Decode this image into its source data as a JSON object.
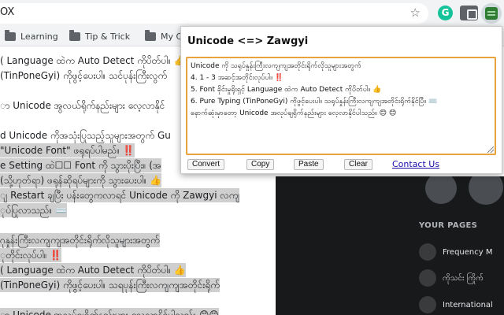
{
  "browser": {
    "url_fragment": "OX",
    "bookmarks": [
      "Learning",
      "Tip & Trick",
      "My C"
    ],
    "extension_icons": [
      "grammarly-icon",
      "bulb-extension-icon",
      "camera-extension-icon",
      "unicode-zawgyi-extension-icon"
    ]
  },
  "page": {
    "lines": [
      {
        "text": "( Language ထဲက Auto Detect ကိုပိတ်ပါ။ 👍",
        "selected": false
      },
      {
        "text": "(TinPoneGyi) ကိုဖွင့်ပေးပါ။ သင်ပုန်းကြီးလွက်",
        "selected": false
      },
      {
        "text": "",
        "selected": false
      },
      {
        "text": "ာ Unicode အွလယ်ရိုက်နည်းများ လေ့လာနိုင်",
        "selected": false
      },
      {
        "text": "",
        "selected": false
      },
      {
        "text": "d Unicode ကိုအသုံးပြုသည့်သူများအတွက် Gu",
        "selected": false
      },
      {
        "text": "\"Unicode Font\" ဖရုရပ်ပါမည်။ ‼️",
        "selected": true
      },
      {
        "text": "e Setting ထဲ☐☐ Font ကို သွားပိုးပြီး။ (အ",
        "selected": true
      },
      {
        "text": "(သို့ဟုတ်ရာ) ဖရုန်ဆိုရပ်များကို သွားပေးပါ။ 👍",
        "selected": true
      },
      {
        "text": "ျ Restart ချပြီး ပန်းတွေကလာရင် Unicode ကို Zawgyi လကျ",
        "selected": true
      },
      {
        "text": "ုပ်ပြုလာသည်။ ⌨️",
        "selected": true
      },
      {
        "text": "",
        "selected": false
      },
      {
        "text": "ဂုနှုန်းကြီးလကျကျအတိုင်းရိုက်လိုသူများအတွက်",
        "selected": true
      },
      {
        "text": "ုတိုင်းလုပ်ပါ။ ‼️",
        "selected": true
      },
      {
        "text": "( Language ထဲက Auto Detect ကိုပိတ်ပါ။ 👍",
        "selected": true
      },
      {
        "text": "(TinPoneGyi) ကိုဖွင့်ပေးပါ။ သရပုန်းကြီးလကျကျအတိုင်းရိုက်",
        "selected": true
      },
      {
        "text": "",
        "selected": false
      },
      {
        "text": "ာ Unicode အလုပ်ချရိုက်နည်းများ လေ့လာနိုင်ပါသည်။ 😊😊",
        "selected": true
      }
    ],
    "right_panel": {
      "pages_title": "YOUR PAGES",
      "pages": [
        "Frequency M",
        "ကိုသင်း ကြိုက်",
        "International"
      ]
    }
  },
  "popup": {
    "title": "Unicode <=> Zawgyi",
    "textarea_lines": [
      "Unicode ကို သရုပ်နှုန်းကြီးလကျကျအတိုင်းရိုက်လိုသူများအတွက်",
      "4. 1 - 3 အဆင့်အတိုင်းလုပ်ပါ။ ‼️",
      "5. Font ခိုင်းမှုရိုးရှင့် Language ထဲက Auto Detect ကိုပိတ်ပါ။ 👍",
      "6. Pure Typing (TinPoneGyi) ကိုဖွင့်ပေးပါ။ သရုပ်နှုန်းကြီးလကျကျအတိုင်းရိုက်နိုင်ပြီ။ ⌨️",
      "နောက်ဆုံးမှာတော့ Unicode အလုပ်ချရိုက်နည်းများ လေ့လာနိုင်ပါသည်။ 😊 😊"
    ],
    "buttons": {
      "convert": "Convert",
      "copy": "Copy",
      "paste": "Paste",
      "clear": "Clear"
    },
    "contact_link": "Contact Us",
    "textarea_border_color": "#e8a33c",
    "link_color": "#1a0dab"
  }
}
